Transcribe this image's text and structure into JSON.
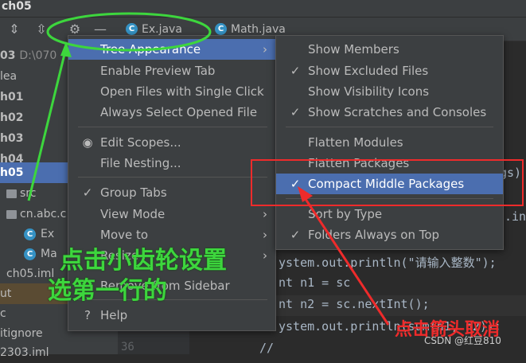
{
  "window": {
    "title": "ch05"
  },
  "project_tree": [
    {
      "label": "03",
      "suffix": "D:\\070",
      "bold": true
    },
    {
      "label": "lea"
    },
    {
      "label": "h01",
      "bold": true
    },
    {
      "label": "h02",
      "bold": true
    },
    {
      "label": "h03",
      "bold": true
    },
    {
      "label": "h04",
      "bold": true
    },
    {
      "label": "h05",
      "bold": true,
      "selected": true
    },
    {
      "label": "src"
    },
    {
      "label": "cn.abc.c"
    },
    {
      "label": "Ex"
    },
    {
      "label": "Ma"
    },
    {
      "label": "ch05.iml"
    },
    {
      "label": "ut",
      "out": true
    },
    {
      "label": "c"
    },
    {
      "label": "itignore"
    },
    {
      "label": "2303.iml"
    }
  ],
  "editor_tabs": [
    {
      "label": "Ex.java"
    },
    {
      "label": "Math.java"
    }
  ],
  "line_numbers": [
    "36"
  ],
  "code_lines": [
    {
      "text": "gs)"
    },
    {
      "text": ".in"
    },
    {
      "text": "ystem.out.println(\"请输入整数\");"
    },
    {
      "text": "nt n1 = sc"
    },
    {
      "text": "nt n2 = sc.nextInt();"
    },
    {
      "text": "ystem.out.println(sum(n1, n2));"
    },
    {
      "text": "//"
    }
  ],
  "main_menu": [
    {
      "label": "Tree Appearance",
      "submenu": true,
      "active": true
    },
    {
      "label": "Enable Preview Tab"
    },
    {
      "label": "Open Files with Single Click"
    },
    {
      "label": "Always Select Opened File"
    },
    {
      "label": "Edit Scopes...",
      "mark": "radio"
    },
    {
      "label": "File Nesting..."
    },
    {
      "label": "Group Tabs",
      "mark": "check"
    },
    {
      "label": "View Mode",
      "submenu": true
    },
    {
      "label": "Move to",
      "submenu": true
    },
    {
      "label": "Resize",
      "submenu": true
    },
    {
      "label": "Remove from Sidebar"
    },
    {
      "label": "Help",
      "mark": "help"
    }
  ],
  "sub_menu": [
    {
      "label": "Show Members"
    },
    {
      "label": "Show Excluded Files",
      "checked": true
    },
    {
      "label": "Show Visibility Icons"
    },
    {
      "label": "Show Scratches and Consoles",
      "checked": true
    },
    {
      "label": "Flatten Modules"
    },
    {
      "label": "Flatten Packages"
    },
    {
      "label": "Compact Middle Packages",
      "checked": true,
      "active": true
    },
    {
      "label": "Sort by Type"
    },
    {
      "label": "Folders Always on Top",
      "checked": true
    }
  ],
  "annotations": {
    "green_line1": "点击小齿轮设置",
    "green_line2": "选第一行的",
    "red": "点击箭头取消"
  },
  "watermark": "CSDN @红豆810",
  "colors": {
    "selection": "#4b6eaf",
    "annotation_green": "#3dd63d",
    "annotation_red": "#ee2b2b"
  }
}
